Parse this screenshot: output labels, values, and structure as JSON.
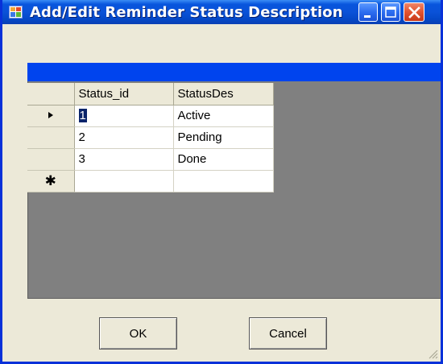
{
  "window": {
    "title": "Add/Edit Reminder Status Description",
    "title_color": "#ffffff",
    "titlebar_color": "#0855dd",
    "close_color": "#e1532f"
  },
  "grid": {
    "caption_color": "#0044ee",
    "columns": [
      "Status_id",
      "StatusDes"
    ],
    "rows": [
      {
        "id": "1",
        "desc": "Active",
        "current": true
      },
      {
        "id": "2",
        "desc": "Pending"
      },
      {
        "id": "3",
        "desc": "Done"
      }
    ],
    "current_row_icon": "arrow-right-icon",
    "new_row_icon": "asterisk-icon",
    "new_row_glyph": "✱",
    "selection_color": "#0a246a"
  },
  "buttons": {
    "ok_label": "OK",
    "cancel_label": "Cancel"
  }
}
